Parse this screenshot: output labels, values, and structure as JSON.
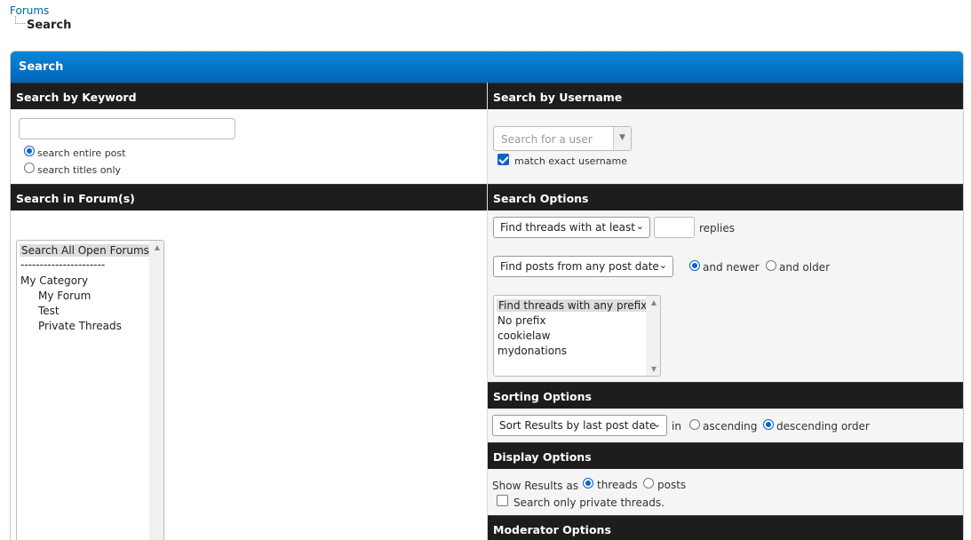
{
  "breadcrumb": {
    "root": "Forums",
    "current": "Search"
  },
  "panel_title": "Search",
  "keyword": {
    "header": "Search by Keyword",
    "value": "",
    "radio_entire": "search entire post",
    "radio_titles": "search titles only"
  },
  "username": {
    "header": "Search by Username",
    "placeholder": "Search for a user",
    "match_exact": "match exact username"
  },
  "forums": {
    "header": "Search in Forum(s)",
    "options": [
      "Search All Open Forums",
      "----------------------",
      "My Category",
      "My Forum",
      "Test",
      "Private Threads"
    ]
  },
  "search_options": {
    "header": "Search Options",
    "replies_select": "Find threads with at least",
    "replies_value": "",
    "replies_label": "replies",
    "date_select": "Find posts from any post date",
    "newer": "and newer",
    "older": "and older",
    "prefix_options": [
      "Find threads with any prefix",
      "No prefix",
      "cookielaw",
      "mydonations"
    ]
  },
  "sorting": {
    "header": "Sorting Options",
    "sort_select": "Sort Results by last post date",
    "in_label": "in",
    "ascending": "ascending",
    "descending": "descending order"
  },
  "display": {
    "header": "Display Options",
    "show_as": "Show Results as",
    "threads": "threads",
    "posts": "posts",
    "private_only": "Search only private threads."
  },
  "moderator": {
    "header": "Moderator Options"
  },
  "icons": {
    "chevron": "chevron-down-icon",
    "scroll_up": "scroll-up-icon",
    "scroll_down": "scroll-down-icon"
  }
}
